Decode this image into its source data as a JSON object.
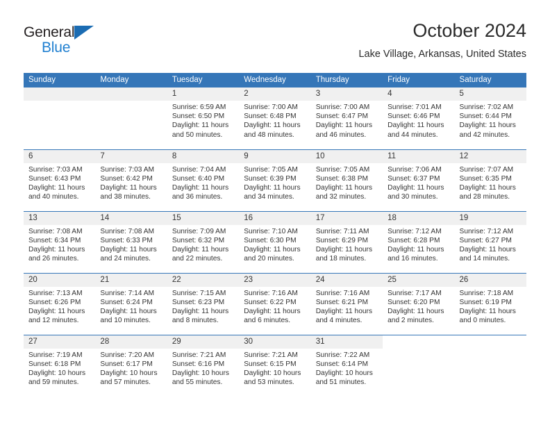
{
  "brand": {
    "name_part1": "General",
    "name_part2": "Blue",
    "triangle_color": "#1b6cb3",
    "blue_text_color": "#1f7fd0"
  },
  "header": {
    "title": "October 2024",
    "location": "Lake Village, Arkansas, United States"
  },
  "theme": {
    "header_blue": "#3576b8",
    "daynum_gray": "#f0f0f0",
    "text_color": "#333333"
  },
  "weekday_headers": [
    "Sunday",
    "Monday",
    "Tuesday",
    "Wednesday",
    "Thursday",
    "Friday",
    "Saturday"
  ],
  "weeks": [
    [
      {
        "day": "",
        "sunrise": "",
        "sunset": "",
        "daylight1": "",
        "daylight2": ""
      },
      {
        "day": "",
        "sunrise": "",
        "sunset": "",
        "daylight1": "",
        "daylight2": ""
      },
      {
        "day": "1",
        "sunrise": "Sunrise: 6:59 AM",
        "sunset": "Sunset: 6:50 PM",
        "daylight1": "Daylight: 11 hours",
        "daylight2": "and 50 minutes."
      },
      {
        "day": "2",
        "sunrise": "Sunrise: 7:00 AM",
        "sunset": "Sunset: 6:48 PM",
        "daylight1": "Daylight: 11 hours",
        "daylight2": "and 48 minutes."
      },
      {
        "day": "3",
        "sunrise": "Sunrise: 7:00 AM",
        "sunset": "Sunset: 6:47 PM",
        "daylight1": "Daylight: 11 hours",
        "daylight2": "and 46 minutes."
      },
      {
        "day": "4",
        "sunrise": "Sunrise: 7:01 AM",
        "sunset": "Sunset: 6:46 PM",
        "daylight1": "Daylight: 11 hours",
        "daylight2": "and 44 minutes."
      },
      {
        "day": "5",
        "sunrise": "Sunrise: 7:02 AM",
        "sunset": "Sunset: 6:44 PM",
        "daylight1": "Daylight: 11 hours",
        "daylight2": "and 42 minutes."
      }
    ],
    [
      {
        "day": "6",
        "sunrise": "Sunrise: 7:03 AM",
        "sunset": "Sunset: 6:43 PM",
        "daylight1": "Daylight: 11 hours",
        "daylight2": "and 40 minutes."
      },
      {
        "day": "7",
        "sunrise": "Sunrise: 7:03 AM",
        "sunset": "Sunset: 6:42 PM",
        "daylight1": "Daylight: 11 hours",
        "daylight2": "and 38 minutes."
      },
      {
        "day": "8",
        "sunrise": "Sunrise: 7:04 AM",
        "sunset": "Sunset: 6:40 PM",
        "daylight1": "Daylight: 11 hours",
        "daylight2": "and 36 minutes."
      },
      {
        "day": "9",
        "sunrise": "Sunrise: 7:05 AM",
        "sunset": "Sunset: 6:39 PM",
        "daylight1": "Daylight: 11 hours",
        "daylight2": "and 34 minutes."
      },
      {
        "day": "10",
        "sunrise": "Sunrise: 7:05 AM",
        "sunset": "Sunset: 6:38 PM",
        "daylight1": "Daylight: 11 hours",
        "daylight2": "and 32 minutes."
      },
      {
        "day": "11",
        "sunrise": "Sunrise: 7:06 AM",
        "sunset": "Sunset: 6:37 PM",
        "daylight1": "Daylight: 11 hours",
        "daylight2": "and 30 minutes."
      },
      {
        "day": "12",
        "sunrise": "Sunrise: 7:07 AM",
        "sunset": "Sunset: 6:35 PM",
        "daylight1": "Daylight: 11 hours",
        "daylight2": "and 28 minutes."
      }
    ],
    [
      {
        "day": "13",
        "sunrise": "Sunrise: 7:08 AM",
        "sunset": "Sunset: 6:34 PM",
        "daylight1": "Daylight: 11 hours",
        "daylight2": "and 26 minutes."
      },
      {
        "day": "14",
        "sunrise": "Sunrise: 7:08 AM",
        "sunset": "Sunset: 6:33 PM",
        "daylight1": "Daylight: 11 hours",
        "daylight2": "and 24 minutes."
      },
      {
        "day": "15",
        "sunrise": "Sunrise: 7:09 AM",
        "sunset": "Sunset: 6:32 PM",
        "daylight1": "Daylight: 11 hours",
        "daylight2": "and 22 minutes."
      },
      {
        "day": "16",
        "sunrise": "Sunrise: 7:10 AM",
        "sunset": "Sunset: 6:30 PM",
        "daylight1": "Daylight: 11 hours",
        "daylight2": "and 20 minutes."
      },
      {
        "day": "17",
        "sunrise": "Sunrise: 7:11 AM",
        "sunset": "Sunset: 6:29 PM",
        "daylight1": "Daylight: 11 hours",
        "daylight2": "and 18 minutes."
      },
      {
        "day": "18",
        "sunrise": "Sunrise: 7:12 AM",
        "sunset": "Sunset: 6:28 PM",
        "daylight1": "Daylight: 11 hours",
        "daylight2": "and 16 minutes."
      },
      {
        "day": "19",
        "sunrise": "Sunrise: 7:12 AM",
        "sunset": "Sunset: 6:27 PM",
        "daylight1": "Daylight: 11 hours",
        "daylight2": "and 14 minutes."
      }
    ],
    [
      {
        "day": "20",
        "sunrise": "Sunrise: 7:13 AM",
        "sunset": "Sunset: 6:26 PM",
        "daylight1": "Daylight: 11 hours",
        "daylight2": "and 12 minutes."
      },
      {
        "day": "21",
        "sunrise": "Sunrise: 7:14 AM",
        "sunset": "Sunset: 6:24 PM",
        "daylight1": "Daylight: 11 hours",
        "daylight2": "and 10 minutes."
      },
      {
        "day": "22",
        "sunrise": "Sunrise: 7:15 AM",
        "sunset": "Sunset: 6:23 PM",
        "daylight1": "Daylight: 11 hours",
        "daylight2": "and 8 minutes."
      },
      {
        "day": "23",
        "sunrise": "Sunrise: 7:16 AM",
        "sunset": "Sunset: 6:22 PM",
        "daylight1": "Daylight: 11 hours",
        "daylight2": "and 6 minutes."
      },
      {
        "day": "24",
        "sunrise": "Sunrise: 7:16 AM",
        "sunset": "Sunset: 6:21 PM",
        "daylight1": "Daylight: 11 hours",
        "daylight2": "and 4 minutes."
      },
      {
        "day": "25",
        "sunrise": "Sunrise: 7:17 AM",
        "sunset": "Sunset: 6:20 PM",
        "daylight1": "Daylight: 11 hours",
        "daylight2": "and 2 minutes."
      },
      {
        "day": "26",
        "sunrise": "Sunrise: 7:18 AM",
        "sunset": "Sunset: 6:19 PM",
        "daylight1": "Daylight: 11 hours",
        "daylight2": "and 0 minutes."
      }
    ],
    [
      {
        "day": "27",
        "sunrise": "Sunrise: 7:19 AM",
        "sunset": "Sunset: 6:18 PM",
        "daylight1": "Daylight: 10 hours",
        "daylight2": "and 59 minutes."
      },
      {
        "day": "28",
        "sunrise": "Sunrise: 7:20 AM",
        "sunset": "Sunset: 6:17 PM",
        "daylight1": "Daylight: 10 hours",
        "daylight2": "and 57 minutes."
      },
      {
        "day": "29",
        "sunrise": "Sunrise: 7:21 AM",
        "sunset": "Sunset: 6:16 PM",
        "daylight1": "Daylight: 10 hours",
        "daylight2": "and 55 minutes."
      },
      {
        "day": "30",
        "sunrise": "Sunrise: 7:21 AM",
        "sunset": "Sunset: 6:15 PM",
        "daylight1": "Daylight: 10 hours",
        "daylight2": "and 53 minutes."
      },
      {
        "day": "31",
        "sunrise": "Sunrise: 7:22 AM",
        "sunset": "Sunset: 6:14 PM",
        "daylight1": "Daylight: 10 hours",
        "daylight2": "and 51 minutes."
      },
      {
        "day": "",
        "sunrise": "",
        "sunset": "",
        "daylight1": "",
        "daylight2": ""
      },
      {
        "day": "",
        "sunrise": "",
        "sunset": "",
        "daylight1": "",
        "daylight2": ""
      }
    ]
  ]
}
